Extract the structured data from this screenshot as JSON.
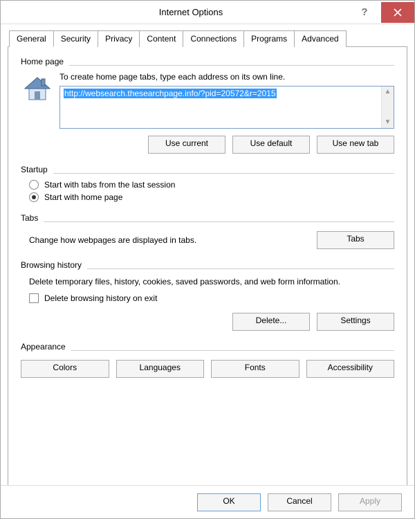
{
  "title": "Internet Options",
  "tabs": [
    "General",
    "Security",
    "Privacy",
    "Content",
    "Connections",
    "Programs",
    "Advanced"
  ],
  "homepage": {
    "section": "Home page",
    "desc": "To create home page tabs, type each address on its own line.",
    "value": "http://websearch.thesearchpage.info/?pid=20572&r=2015",
    "use_current": "Use current",
    "use_default": "Use default",
    "use_new_tab": "Use new tab"
  },
  "startup": {
    "section": "Startup",
    "opt_last": "Start with tabs from the last session",
    "opt_home": "Start with home page"
  },
  "tabs_section": {
    "section": "Tabs",
    "desc": "Change how webpages are displayed in tabs.",
    "button": "Tabs"
  },
  "history": {
    "section": "Browsing history",
    "desc": "Delete temporary files, history, cookies, saved passwords, and web form information.",
    "checkbox": "Delete browsing history on exit",
    "delete": "Delete...",
    "settings": "Settings"
  },
  "appearance": {
    "section": "Appearance",
    "colors": "Colors",
    "languages": "Languages",
    "fonts": "Fonts",
    "accessibility": "Accessibility"
  },
  "footer": {
    "ok": "OK",
    "cancel": "Cancel",
    "apply": "Apply"
  }
}
